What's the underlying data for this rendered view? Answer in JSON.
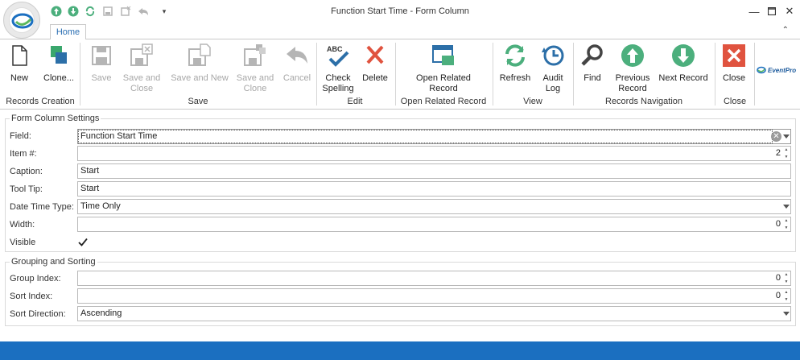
{
  "window": {
    "title": "Function Start Time - Form Column",
    "tabs": [
      "Home"
    ]
  },
  "ribbon": {
    "groups": {
      "records_creation": "Records Creation",
      "save": "Save",
      "edit": "Edit",
      "open_related": "Open Related Record",
      "view": "View",
      "navigation": "Records Navigation",
      "close": "Close"
    },
    "buttons": {
      "new": "New",
      "clone": "Clone...",
      "save": "Save",
      "save_close_1": "Save and",
      "save_close_2": "Close",
      "save_new": "Save and New",
      "save_clone_1": "Save and",
      "save_clone_2": "Clone",
      "cancel": "Cancel",
      "check_spelling_1": "Check",
      "check_spelling_2": "Spelling",
      "spell_badge": "ABC",
      "delete": "Delete",
      "open_related_1": "Open Related",
      "open_related_2": "Record",
      "refresh": "Refresh",
      "audit_1": "Audit",
      "audit_2": "Log",
      "find": "Find",
      "previous_1": "Previous",
      "previous_2": "Record",
      "next": "Next Record",
      "close": "Close"
    },
    "brand": "EventPro"
  },
  "form": {
    "settings_title": "Form Column Settings",
    "labels": {
      "field": "Field:",
      "item": "Item #:",
      "caption": "Caption:",
      "tooltip": "Tool Tip:",
      "datetime_type": "Date Time Type:",
      "width": "Width:",
      "visible": "Visible"
    },
    "values": {
      "field": "Function Start Time",
      "item": "2",
      "caption": "Start",
      "tooltip": "Start",
      "datetime_type": "Time Only",
      "width": "0",
      "visible": true
    },
    "grouping_title": "Grouping and Sorting",
    "grouping_labels": {
      "group_index": "Group Index:",
      "sort_index": "Sort Index:",
      "sort_direction": "Sort Direction:"
    },
    "grouping_values": {
      "group_index": "0",
      "sort_index": "0",
      "sort_direction": "Ascending"
    }
  },
  "colors": {
    "accent": "#1b6fc0",
    "green": "#4caf7d",
    "red": "#e0533f",
    "disabled": "#a7a7a7"
  }
}
